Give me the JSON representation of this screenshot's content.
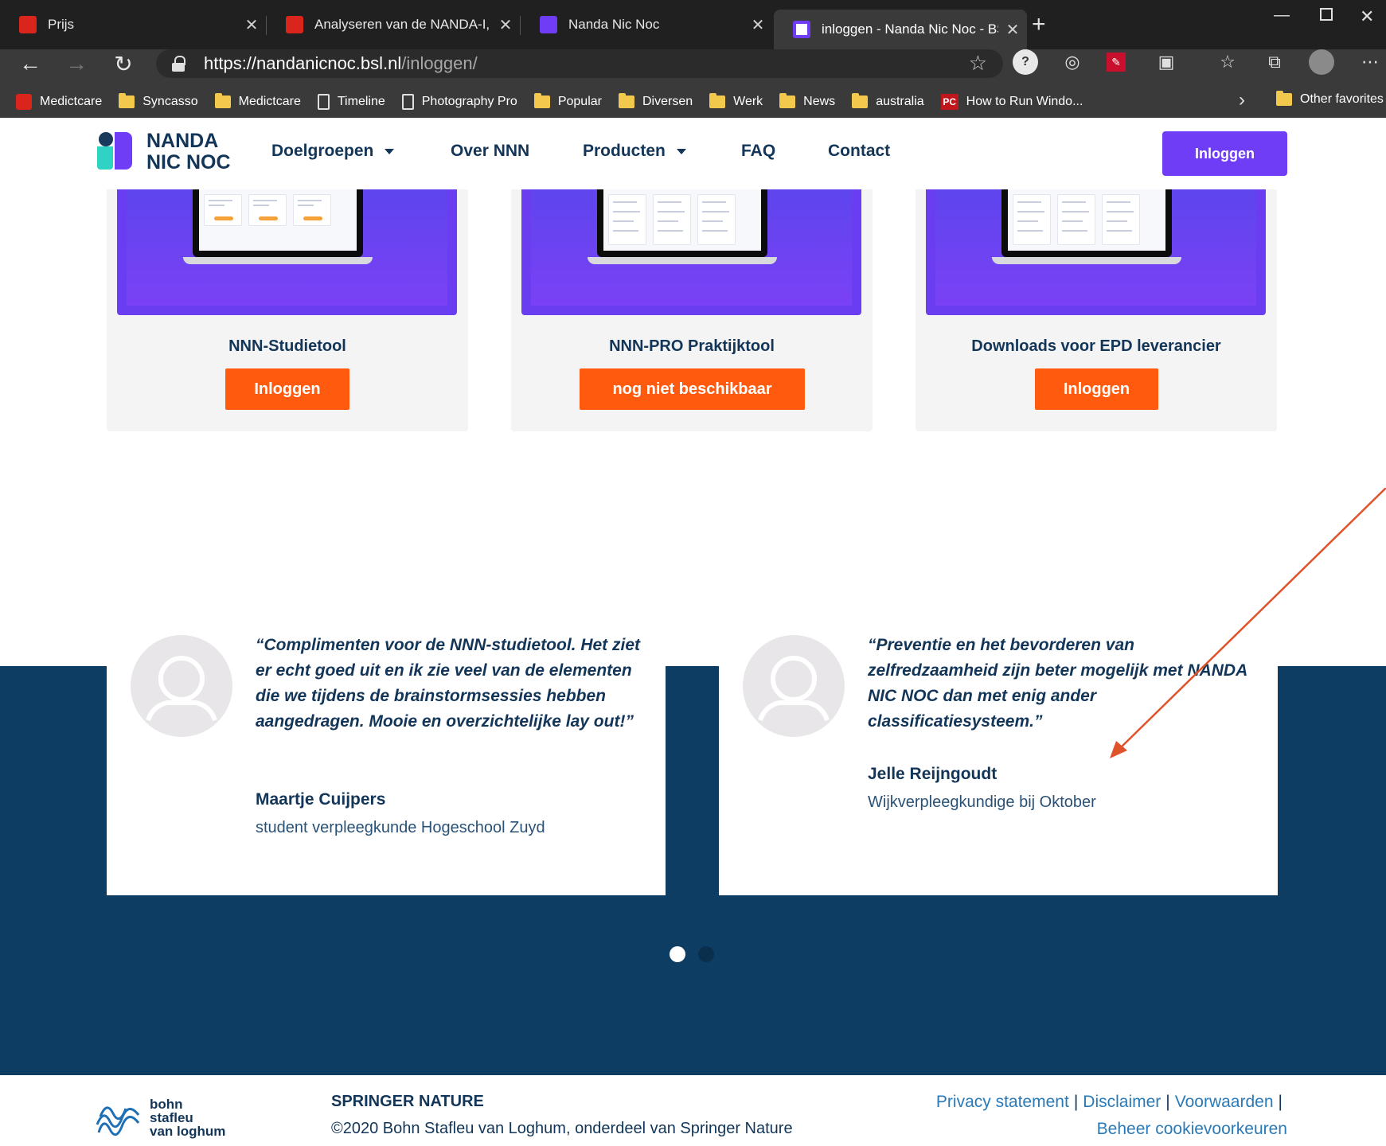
{
  "browser": {
    "tabs": [
      {
        "label": "Prijs",
        "favicon": "medictcare-favicon",
        "color": "#d9251c"
      },
      {
        "label": "Analyseren van de NANDA-I, NO",
        "favicon": "medictcare-favicon",
        "color": "#d9251c"
      },
      {
        "label": "Nanda Nic Noc",
        "favicon": "nnn-favicon",
        "color": "#6f3df5"
      },
      {
        "label": "inloggen - Nanda Nic Noc - BSL",
        "favicon": "nnn-favicon",
        "color": "#6f3df5"
      }
    ],
    "active_tab": 3,
    "url_host": "https://nandanicnoc.bsl.nl",
    "url_path": "/inloggen/",
    "bookmarks": [
      {
        "label": "Medictcare",
        "icon": "red"
      },
      {
        "label": "Syncasso",
        "icon": "folder"
      },
      {
        "label": "Medictcare",
        "icon": "folder"
      },
      {
        "label": "Timeline",
        "icon": "page"
      },
      {
        "label": "Photography Pro",
        "icon": "page"
      },
      {
        "label": "Popular",
        "icon": "folder"
      },
      {
        "label": "Diversen",
        "icon": "folder"
      },
      {
        "label": "Werk",
        "icon": "folder"
      },
      {
        "label": "News",
        "icon": "folder"
      },
      {
        "label": "australia",
        "icon": "folder"
      },
      {
        "label": "How to Run Windo...",
        "icon": "pc"
      }
    ],
    "other_favorites": "Other favorites",
    "pc_icon_text": "PC"
  },
  "site": {
    "logo_line1": "NANDA",
    "logo_line2": "NIC NOC",
    "nav": {
      "doelgroepen": "Doelgroepen",
      "over": "Over NNN",
      "producten": "Producten",
      "faq": "FAQ",
      "contact": "Contact"
    },
    "login_button": "Inloggen",
    "colors": {
      "primary": "#6f3df5",
      "navy": "#0e3d63",
      "orange": "#ff5a0d",
      "teal": "#2ed3c4"
    }
  },
  "products": [
    {
      "title": "NNN-Studietool",
      "button": "Inloggen"
    },
    {
      "title": "NNN-PRO Praktijktool",
      "button": "nog niet beschikbaar"
    },
    {
      "title": "Downloads voor EPD leverancier",
      "button": "Inloggen"
    }
  ],
  "testimonials": [
    {
      "quote": "“Complimenten voor de NNN-studietool. Het ziet er echt goed uit en ik zie veel van de elementen die we tijdens de brainstormsessies hebben aangedragen. Mooie en overzichtelijke lay out!”",
      "name": "Maartje Cuijpers",
      "role": "student verpleegkunde Hogeschool Zuyd"
    },
    {
      "quote": "“Preventie en het bevorderen van zelfredzaamheid zijn beter mogelijk met NANDA NIC NOC dan met enig ander classificatiesysteem.”",
      "name": "Jelle Reijngoudt",
      "role": "Wijkverpleegkundige bij Oktober"
    }
  ],
  "carousel": {
    "pages": 2,
    "active": 0
  },
  "footer": {
    "publisher_line1": "bohn",
    "publisher_line2": "stafleu",
    "publisher_line3": "van loghum",
    "brand": "SPRINGER NATURE",
    "copyright": "©2020 Bohn Stafleu van Loghum, onderdeel van Springer Nature",
    "links": {
      "privacy": "Privacy statement",
      "disclaimer": "Disclaimer",
      "voorwaarden": "Voorwaarden",
      "cookies": "Beheer cookievoorkeuren"
    }
  }
}
